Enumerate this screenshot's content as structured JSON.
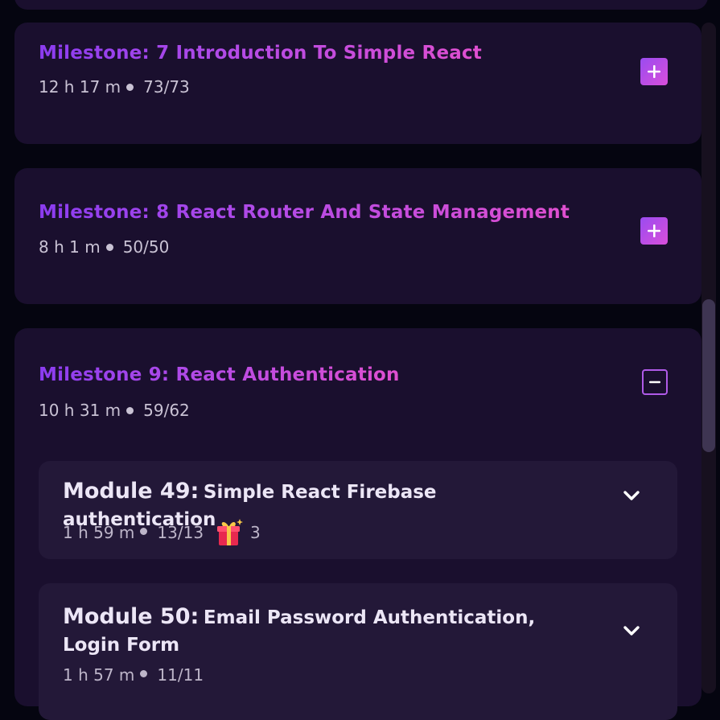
{
  "milestones": [
    {
      "title": "Milestone: 7 Introduction To Simple React",
      "duration": "12 h 17 m",
      "progress": "73/73",
      "toggle": "plus-icon"
    },
    {
      "title": "Milestone: 8 React Router And State Management",
      "duration": "8 h 1 m",
      "progress": "50/50",
      "toggle": "plus-icon"
    },
    {
      "title": "Milestone 9: React Authentication",
      "duration": "10 h 31 m",
      "progress": "59/62",
      "toggle": "minus-icon"
    }
  ],
  "modules": [
    {
      "number": "Module 49:",
      "name": "Simple React Firebase authentication",
      "duration": "1 h 59 m",
      "progress": "13/13",
      "gift_count": "3",
      "icon": "chevron-down-icon"
    },
    {
      "number": "Module 50:",
      "name": "Email Password Authentication, Login Form",
      "duration": "1 h 57 m",
      "progress": "11/11",
      "icon": "chevron-down-icon"
    }
  ],
  "colors": {
    "background": "#050510",
    "card": "#1a0f2e",
    "module_card": "#231838",
    "accent_start": "#8b3cf0",
    "accent_end": "#e04fd0",
    "gift": "#e8294f"
  }
}
